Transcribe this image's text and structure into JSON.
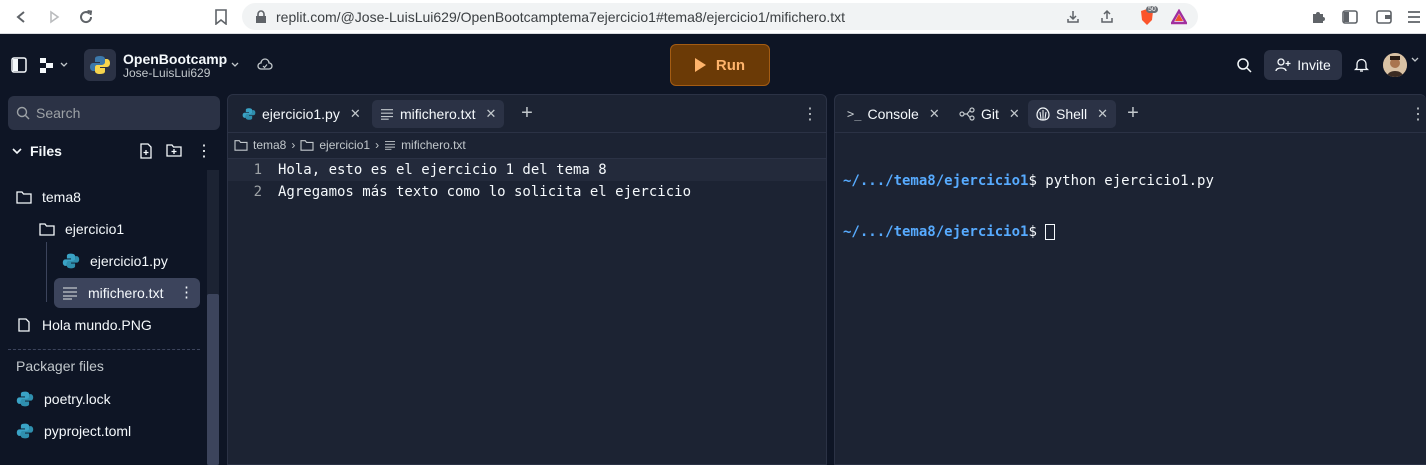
{
  "browser": {
    "url": "replit.com/@Jose-LuisLui629/OpenBootcamptema7ejercicio1#tema8/ejercicio1/mifichero.txt",
    "brave_badge": "50"
  },
  "header": {
    "repl_name": "OpenBootcamp",
    "repl_owner": "Jose-LuisLui629",
    "run_label": "Run",
    "invite_label": "Invite"
  },
  "sidebar": {
    "search_placeholder": "Search",
    "files_title": "Files",
    "tree": [
      {
        "label": "tema8",
        "type": "folder"
      },
      {
        "label": "ejercicio1",
        "type": "folder"
      },
      {
        "label": "ejercicio1.py",
        "type": "python"
      },
      {
        "label": "mifichero.txt",
        "type": "text",
        "selected": true
      },
      {
        "label": "Hola mundo.PNG",
        "type": "image"
      }
    ],
    "packager_title": "Packager files",
    "packager_files": [
      {
        "label": "poetry.lock"
      },
      {
        "label": "pyproject.toml"
      }
    ]
  },
  "editor": {
    "tabs": [
      {
        "label": "ejercicio1.py",
        "icon": "python-icon"
      },
      {
        "label": "mifichero.txt",
        "icon": "text-file-icon",
        "active": true
      }
    ],
    "breadcrumb": [
      "tema8",
      "ejercicio1",
      "mifichero.txt"
    ],
    "lines": [
      {
        "num": "1",
        "text": "Hola, esto es el ejercicio 1 del tema 8"
      },
      {
        "num": "2",
        "text": "Agregamos más texto como lo solicita el ejercicio"
      }
    ]
  },
  "console": {
    "tabs": [
      {
        "label": "Console",
        "icon": "console-icon"
      },
      {
        "label": "Git",
        "icon": "git-icon"
      },
      {
        "label": "Shell",
        "icon": "shell-icon",
        "active": true
      }
    ],
    "lines": [
      {
        "path": "~/.../tema8/ejercicio1",
        "prompt": "$ ",
        "cmd": "python ejercicio1.py"
      },
      {
        "path": "~/.../tema8/ejercicio1",
        "prompt": "$ ",
        "cmd": ""
      }
    ]
  },
  "colors": {
    "background": "#0e1525",
    "pane": "#1c2333",
    "run_button": "#6b3a06",
    "run_text": "#ffb46b",
    "terminal_path": "#57abff"
  }
}
